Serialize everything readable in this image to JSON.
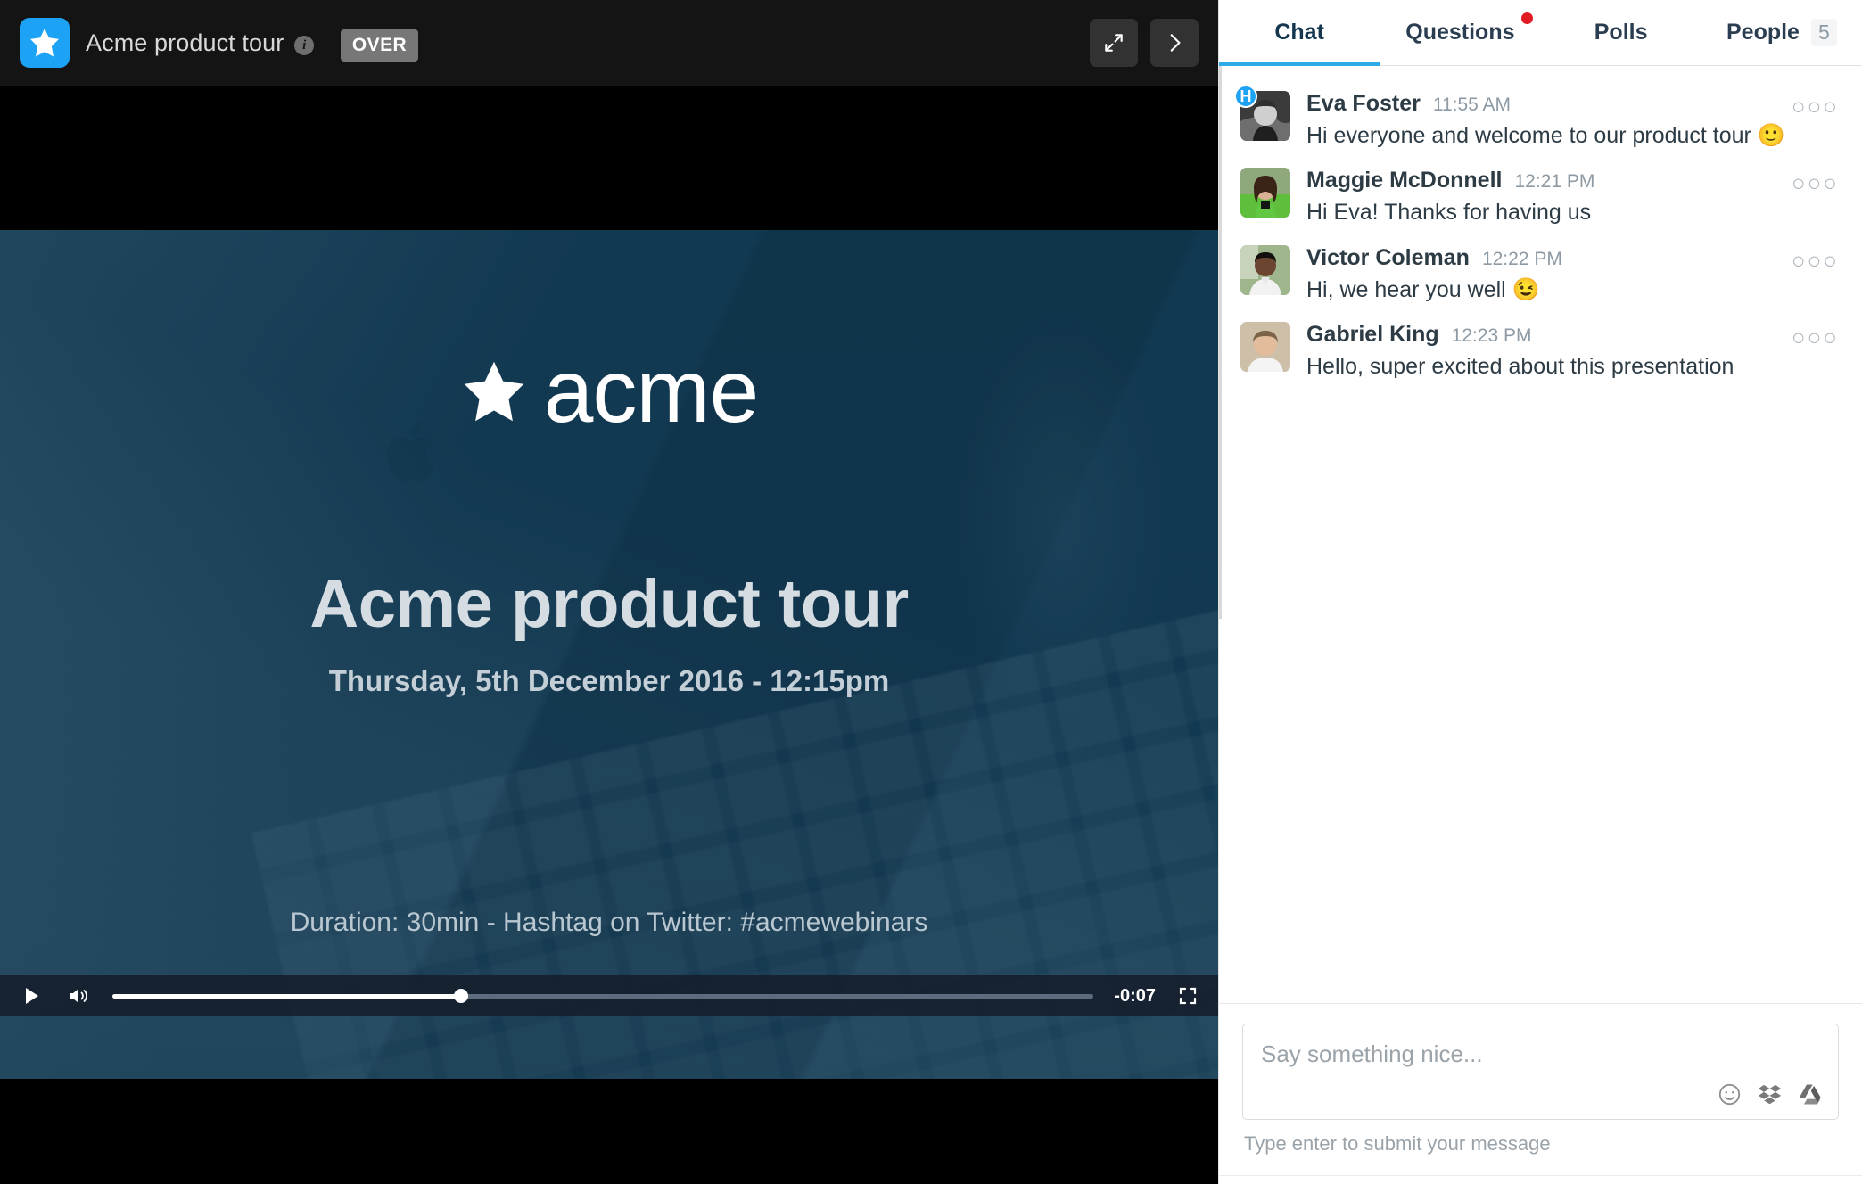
{
  "stage": {
    "brand_icon": "star-icon",
    "title": "Acme product tour",
    "info_icon": "info-icon",
    "info_glyph": "i",
    "status_badge": "OVER",
    "expand_icon": "expand-diagonal-icon",
    "next_icon": "chevron-right-icon",
    "accent_blue": "#1ca3f5",
    "header_bg": "#141414"
  },
  "slide": {
    "logo_star_icon": "star-icon",
    "logo_word": "acme",
    "title": "Acme product tour",
    "date": "Thursday, 5th December 2016 - 12:15pm",
    "footnote": "Duration: 30min - Hashtag on Twitter: #acmewebinars",
    "background_tint": "#143a54",
    "apple_logo_icon": "apple-logo-icon"
  },
  "controls": {
    "play_icon": "play-icon",
    "volume_icon": "volume-icon",
    "fullscreen_icon": "fullscreen-icon",
    "time_remaining": "-0:07",
    "progress_percent": 35.5
  },
  "panel": {
    "tabs": [
      {
        "label": "Chat",
        "active": true,
        "badge": null,
        "dot": false
      },
      {
        "label": "Questions",
        "active": false,
        "badge": null,
        "dot": true
      },
      {
        "label": "Polls",
        "active": false,
        "badge": null,
        "dot": false
      },
      {
        "label": "People",
        "active": false,
        "badge": "5",
        "dot": false
      }
    ],
    "active_tab_color": "#2dabe8",
    "notification_dot_color": "#e01b24",
    "messages": [
      {
        "name": "Eva Foster",
        "time": "11:55 AM",
        "text": "Hi everyone and welcome to our product tour",
        "emoji": "🙂",
        "host": true,
        "host_badge": "H",
        "more_icon": "more-options-icon"
      },
      {
        "name": "Maggie McDonnell",
        "time": "12:21 PM",
        "text": "Hi Eva! Thanks for having us",
        "emoji": "",
        "host": false,
        "host_badge": "",
        "more_icon": "more-options-icon"
      },
      {
        "name": "Victor Coleman",
        "time": "12:22 PM",
        "text": "Hi, we hear you well",
        "emoji": "😉",
        "host": false,
        "host_badge": "",
        "more_icon": "more-options-icon"
      },
      {
        "name": "Gabriel King",
        "time": "12:23 PM",
        "text": "Hello, super excited about this presentation",
        "emoji": "",
        "host": false,
        "host_badge": "",
        "more_icon": "more-options-icon"
      }
    ],
    "composer": {
      "value": "",
      "placeholder": "Say something nice...",
      "hint": "Type enter to submit your message",
      "emoji_icon": "emoji-smiley-icon",
      "dropbox_icon": "dropbox-icon",
      "gdrive_icon": "google-drive-icon"
    }
  }
}
